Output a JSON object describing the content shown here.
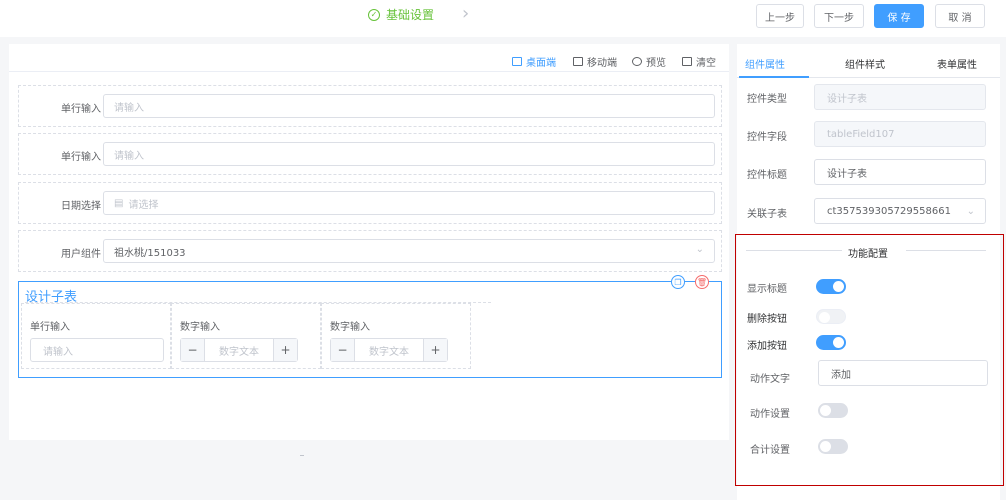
{
  "header": {
    "step_label": "基础设置",
    "buttons": {
      "prev": "上一步",
      "next": "下一步",
      "save": "保 存",
      "cancel": "取 消"
    }
  },
  "canvas_toolbar": {
    "desktop": "桌面端",
    "mobile": "移动端",
    "preview": "预览",
    "clear": "清空"
  },
  "form_fields": [
    {
      "label": "单行输入",
      "placeholder": "请输入"
    },
    {
      "label": "单行输入",
      "placeholder": "请输入"
    },
    {
      "label": "日期选择",
      "placeholder": "请选择"
    },
    {
      "label": "用户组件",
      "value": "祖水桃/151033"
    }
  ],
  "subtable": {
    "title": "设计子表",
    "columns": [
      {
        "label": "单行输入",
        "placeholder": "请输入"
      },
      {
        "label": "数字输入",
        "placeholder": "数字文本",
        "minus": "−",
        "plus": "+"
      },
      {
        "label": "数字输入",
        "placeholder": "数字文本",
        "minus": "−",
        "plus": "+"
      }
    ]
  },
  "right_panel": {
    "tabs": [
      "组件属性",
      "组件样式",
      "表单属性"
    ],
    "props": [
      {
        "label": "控件类型",
        "value": "设计子表",
        "disabled": true
      },
      {
        "label": "控件字段",
        "value": "tableField107",
        "disabled": true
      },
      {
        "label": "控件标题",
        "value": "设计子表",
        "disabled": false
      },
      {
        "label": "关联子表",
        "value": "ct357539305729558661",
        "disabled": false
      }
    ],
    "function_config": {
      "title": "功能配置",
      "show_title": {
        "label": "显示标题",
        "on": true
      },
      "delete_button": {
        "label": "删除按钮",
        "on": false
      },
      "add_button": {
        "label": "添加按钮",
        "on": true
      },
      "action_text": {
        "label": "动作文字",
        "value": "添加"
      },
      "action_setting": {
        "label": "动作设置",
        "on": false
      },
      "sum_setting": {
        "label": "合计设置",
        "on": false
      }
    }
  },
  "colors": {
    "primary": "#409eff",
    "success": "#67c23a",
    "danger": "#f56c6c",
    "highlight_border": "#c00000"
  }
}
